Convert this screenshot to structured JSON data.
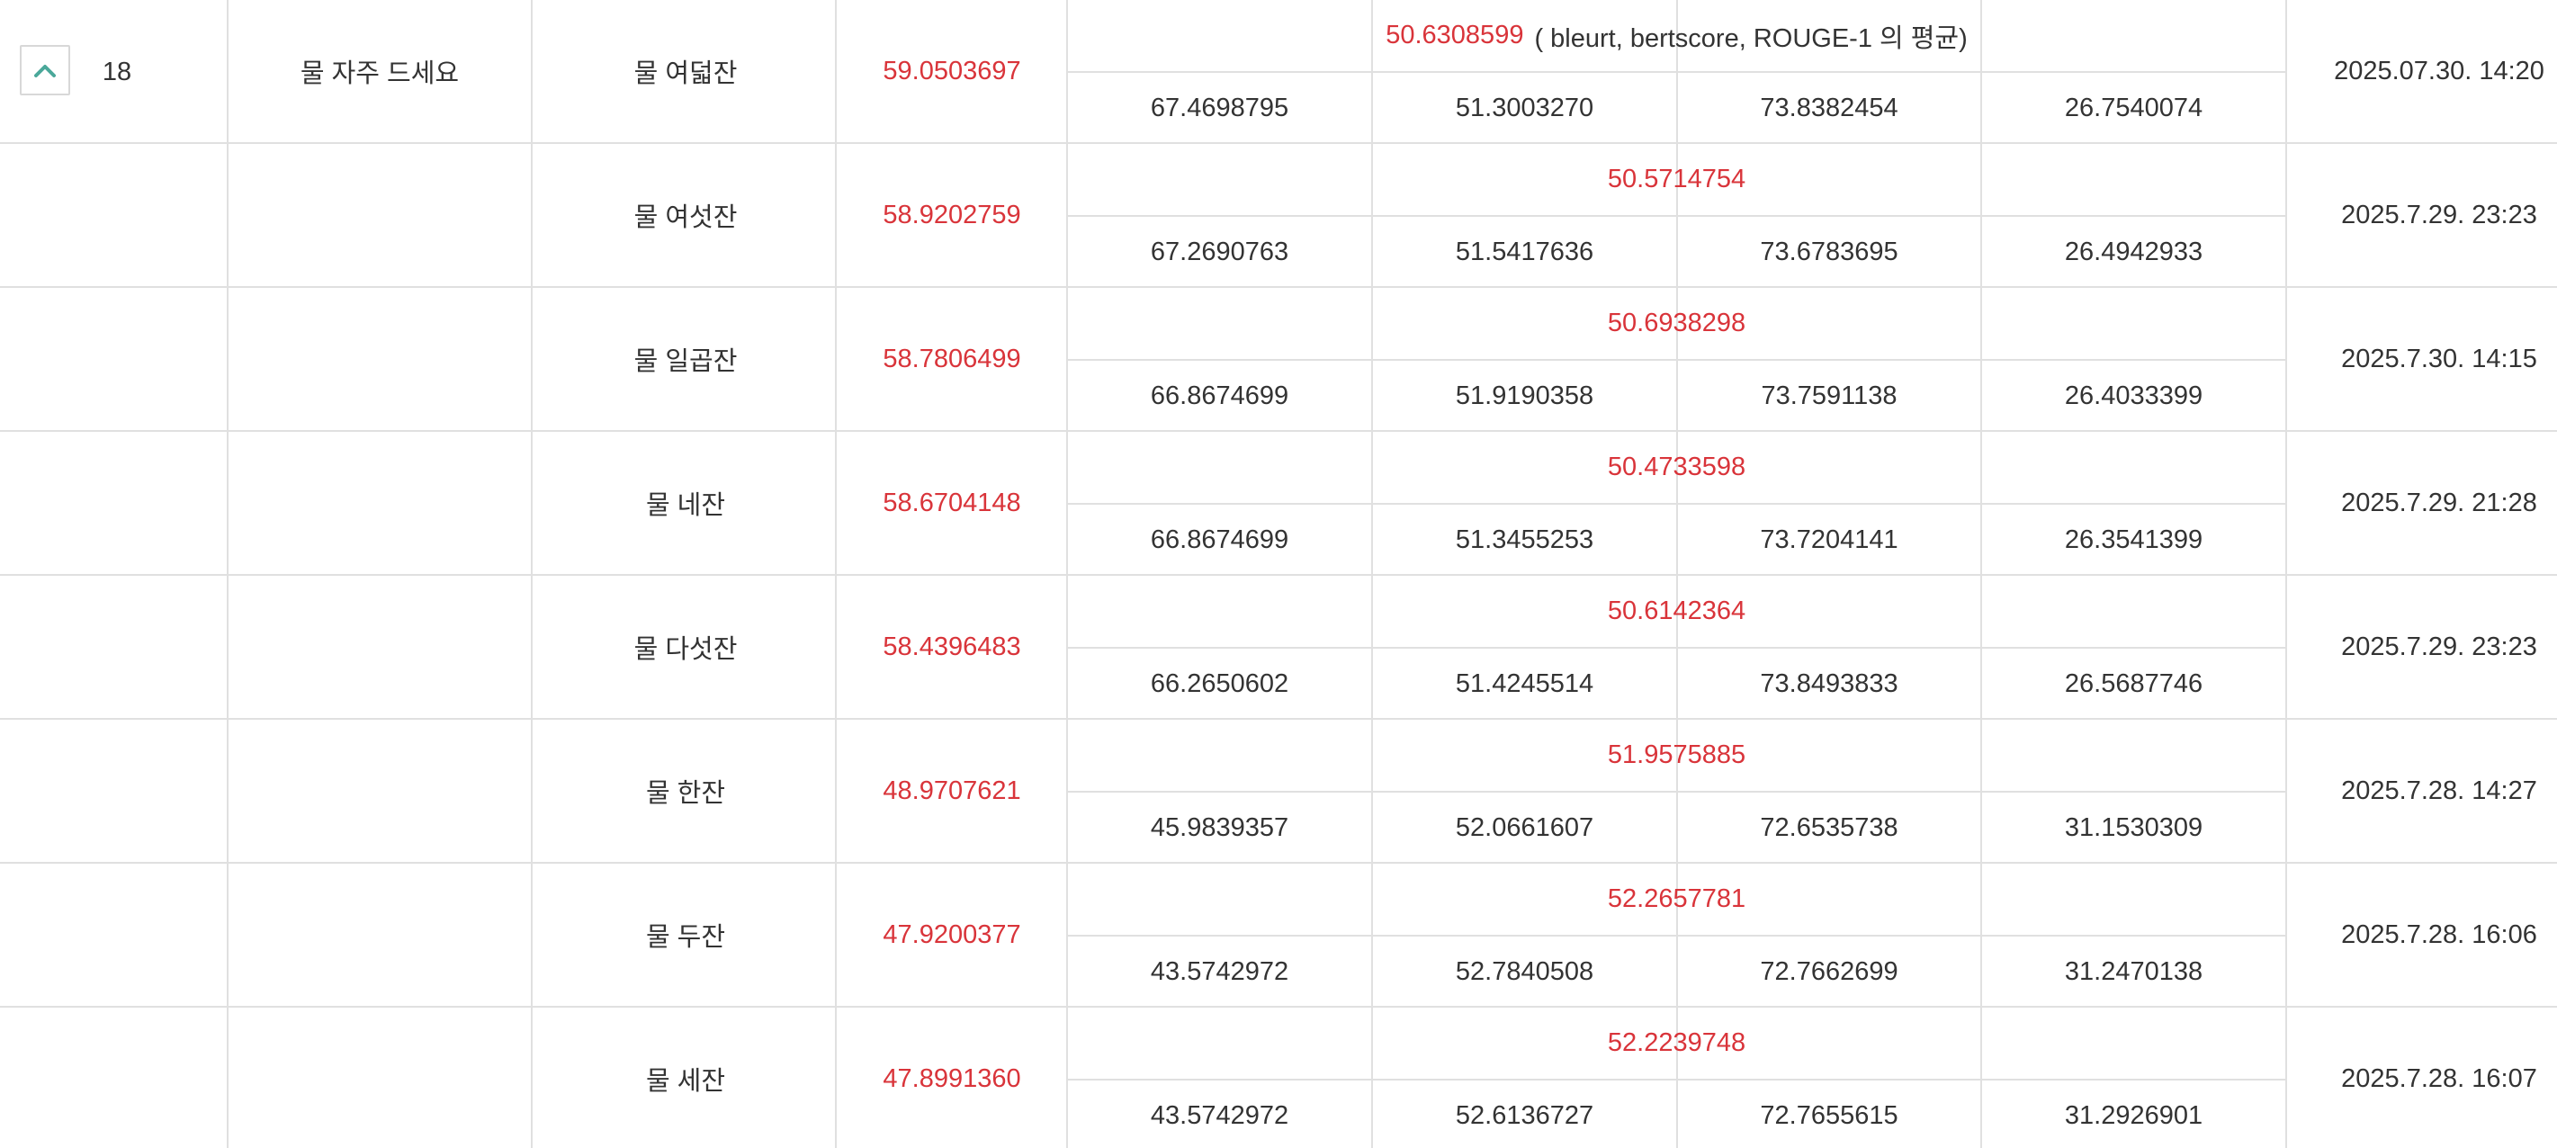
{
  "group": {
    "number": "18",
    "user_name": "물 자주 드세요",
    "collapse_icon": "chevron-up-icon",
    "icon_color": "#4aa89a"
  },
  "colors": {
    "highlight": "#d9343a",
    "text": "#333333",
    "grid": "#e0e0e0"
  },
  "average_note": "( bleurt, bertscore, ROUGE-1 의 평균)",
  "rows": [
    {
      "team": "물 여덟잔",
      "score": "59.0503697",
      "average": "50.6308599",
      "metrics": [
        "67.4698795",
        "51.3003270",
        "73.8382454",
        "26.7540074"
      ],
      "timestamp": "2025.07.30. 14:20"
    },
    {
      "team": "물 여섯잔",
      "score": "58.9202759",
      "average": "50.5714754",
      "metrics": [
        "67.2690763",
        "51.5417636",
        "73.6783695",
        "26.4942933"
      ],
      "timestamp": "2025.7.29. 23:23"
    },
    {
      "team": "물 일곱잔",
      "score": "58.7806499",
      "average": "50.6938298",
      "metrics": [
        "66.8674699",
        "51.9190358",
        "73.7591138",
        "26.4033399"
      ],
      "timestamp": "2025.7.30. 14:15"
    },
    {
      "team": "물 네잔",
      "score": "58.6704148",
      "average": "50.4733598",
      "metrics": [
        "66.8674699",
        "51.3455253",
        "73.7204141",
        "26.3541399"
      ],
      "timestamp": "2025.7.29. 21:28"
    },
    {
      "team": "물 다섯잔",
      "score": "58.4396483",
      "average": "50.6142364",
      "metrics": [
        "66.2650602",
        "51.4245514",
        "73.8493833",
        "26.5687746"
      ],
      "timestamp": "2025.7.29. 23:23"
    },
    {
      "team": "물 한잔",
      "score": "48.9707621",
      "average": "51.9575885",
      "metrics": [
        "45.9839357",
        "52.0661607",
        "72.6535738",
        "31.1530309"
      ],
      "timestamp": "2025.7.28. 14:27"
    },
    {
      "team": "물 두잔",
      "score": "47.9200377",
      "average": "52.2657781",
      "metrics": [
        "43.5742972",
        "52.7840508",
        "72.7662699",
        "31.2470138"
      ],
      "timestamp": "2025.7.28. 16:06"
    },
    {
      "team": "물 세잔",
      "score": "47.8991360",
      "average": "52.2239748",
      "metrics": [
        "43.5742972",
        "52.6136727",
        "72.7655615",
        "31.2926901"
      ],
      "timestamp": "2025.7.28. 16:07"
    }
  ]
}
